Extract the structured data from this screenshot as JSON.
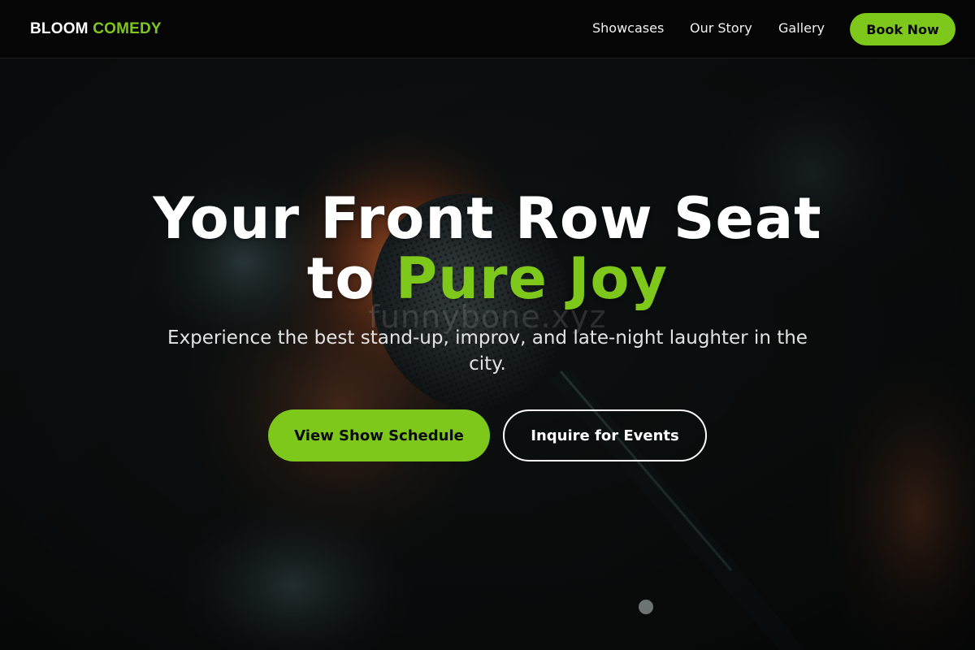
{
  "brand": {
    "name_white": "BLOOM",
    "name_green": "COMEDY"
  },
  "nav": {
    "links": [
      {
        "label": "Showcases"
      },
      {
        "label": "Our Story"
      },
      {
        "label": "Gallery"
      }
    ],
    "cta_label": "Book Now"
  },
  "hero": {
    "headline_line1": "Your Front Row Seat",
    "headline_to": "to",
    "headline_accent": "Pure Joy",
    "subheadline": "Experience the best stand-up, improv, and late-night laughter in the city.",
    "watermark": "funnybone.xyz",
    "primary_cta": "View Show Schedule",
    "secondary_cta": "Inquire for Events",
    "background_image": "microphone-on-stage-photo"
  },
  "colors": {
    "accent": "#7ec81c",
    "nav_bg": "#050505",
    "text": "#ffffff"
  }
}
